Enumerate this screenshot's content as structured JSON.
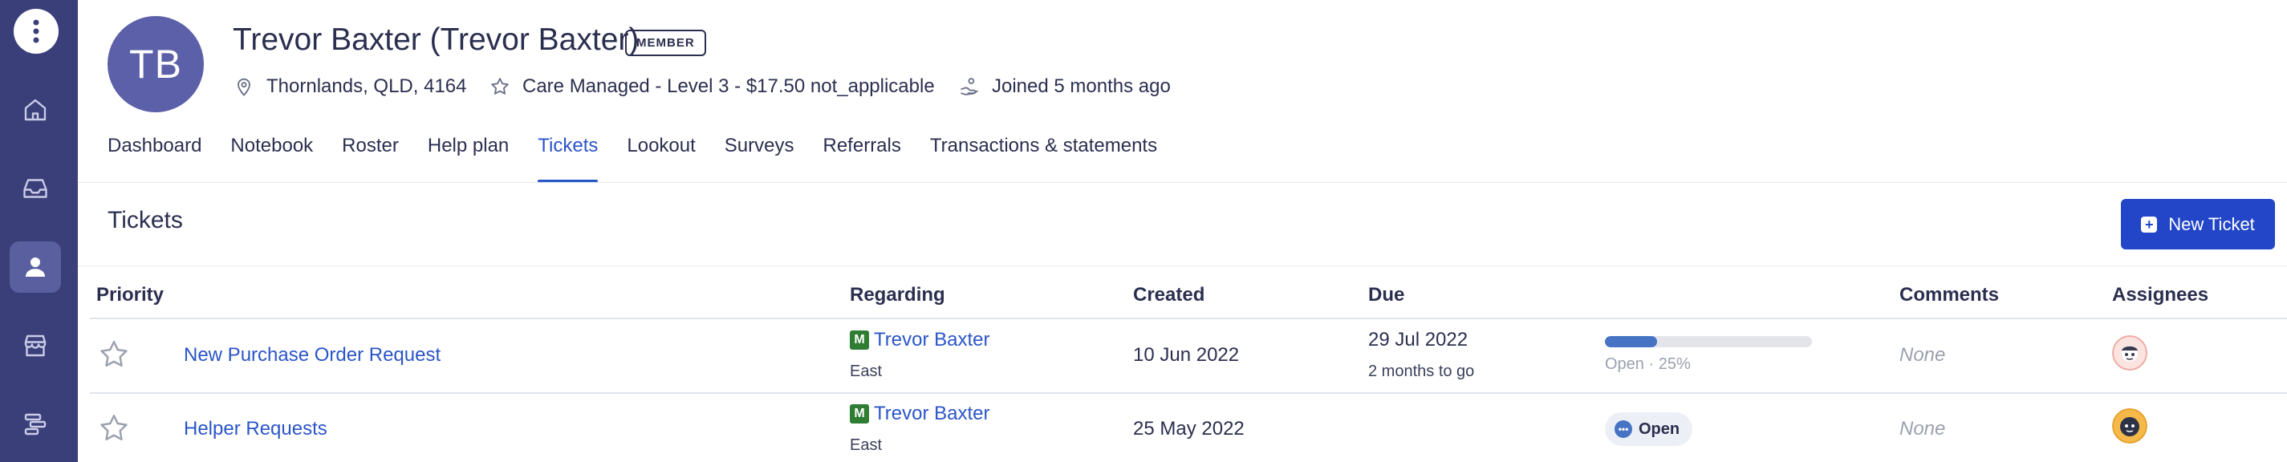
{
  "profile": {
    "initials": "TB",
    "name": "Trevor Baxter (Trevor Baxter)",
    "badge": "MEMBER",
    "location": "Thornlands, QLD, 4164",
    "plan": "Care Managed - Level 3 - $17.50 not_applicable",
    "joined": "Joined 5 months ago"
  },
  "sidebar": {
    "items": [
      {
        "icon": "home-icon"
      },
      {
        "icon": "inbox-icon"
      },
      {
        "icon": "user-icon",
        "active": true
      },
      {
        "icon": "store-icon"
      },
      {
        "icon": "timeline-icon"
      }
    ]
  },
  "tabs": [
    {
      "label": "Dashboard"
    },
    {
      "label": "Notebook"
    },
    {
      "label": "Roster"
    },
    {
      "label": "Help plan"
    },
    {
      "label": "Tickets",
      "active": true
    },
    {
      "label": "Lookout"
    },
    {
      "label": "Surveys"
    },
    {
      "label": "Referrals"
    },
    {
      "label": "Transactions & statements"
    }
  ],
  "section": {
    "title": "Tickets",
    "new_button": "New Ticket"
  },
  "table": {
    "headers": {
      "priority": "Priority",
      "regarding": "Regarding",
      "created": "Created",
      "due": "Due",
      "comments": "Comments",
      "assignees": "Assignees"
    },
    "rows": [
      {
        "title": "New Purchase Order Request",
        "regarding_badge": "M",
        "regarding_name": "Trevor Baxter",
        "region": "East",
        "created": "10 Jun 2022",
        "due": "29 Jul 2022",
        "due_relative": "2 months to go",
        "progress": 0.25,
        "progress_label": "Open · 25%",
        "comments": "None"
      },
      {
        "title": "Helper Requests",
        "regarding_badge": "M",
        "regarding_name": "Trevor Baxter",
        "region": "East",
        "created": "25 May 2022",
        "status": "Open",
        "comments": "None"
      }
    ]
  },
  "colors": {
    "sidebar": "#3a3f7a",
    "accent": "#2b55c8",
    "button": "#2346c8",
    "avatar": "#5b60a8"
  }
}
